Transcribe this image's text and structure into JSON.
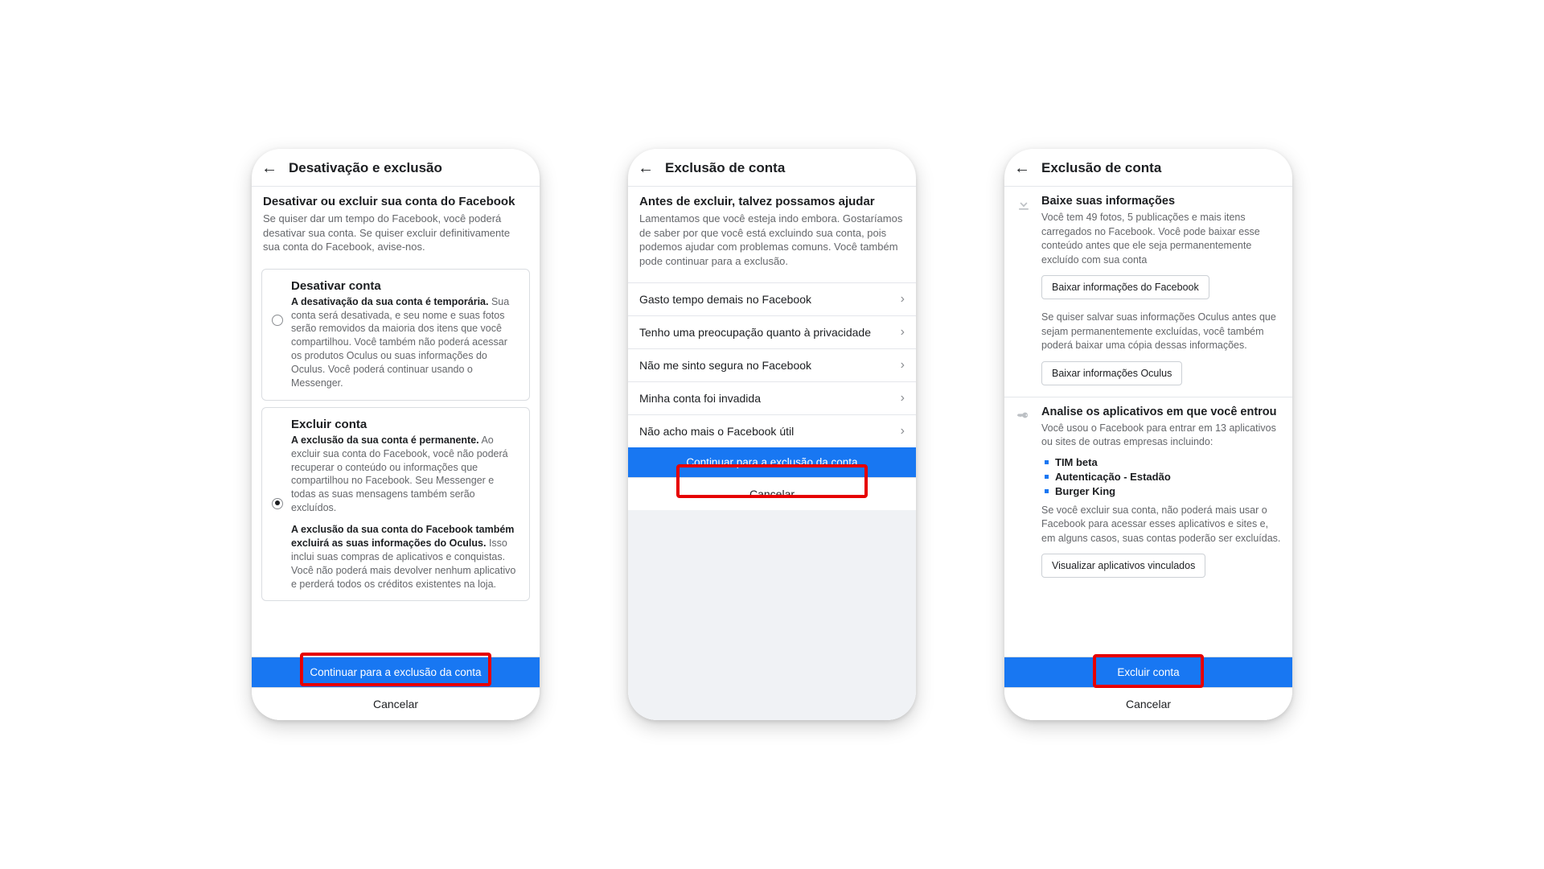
{
  "phone1": {
    "header": "Desativação e exclusão",
    "section_title": "Desativar ou excluir sua conta do Facebook",
    "section_desc": "Se quiser dar um tempo do Facebook, você poderá desativar sua conta. Se quiser excluir definitivamente sua conta do Facebook, avise-nos.",
    "opt_a_title": "Desativar conta",
    "opt_a_bold": "A desativação da sua conta é temporária.",
    "opt_a_rest": " Sua conta será desativada, e seu nome e suas fotos serão removidos da maioria dos itens que você compartilhou. Você também não poderá acessar os produtos Oculus ou suas informações do Oculus. Você poderá continuar usando o Messenger.",
    "opt_b_title": "Excluir conta",
    "opt_b_bold": "A exclusão da sua conta é permanente.",
    "opt_b_rest": " Ao excluir sua conta do Facebook, você não poderá recuperar o conteúdo ou informações que compartilhou no Facebook. Seu Messenger e todas as suas mensagens também serão excluídos.",
    "opt_b_bold2": "A exclusão da sua conta do Facebook também excluirá as suas informações do Oculus.",
    "opt_b_rest2": " Isso inclui suas compras de aplicativos e conquistas. Você não poderá mais devolver nenhum aplicativo e perderá todos os créditos existentes na loja.",
    "continue": "Continuar para a exclusão da conta",
    "cancel": "Cancelar"
  },
  "phone2": {
    "header": "Exclusão de conta",
    "title": "Antes de excluir, talvez possamos ajudar",
    "desc": "Lamentamos que você esteja indo embora. Gostaríamos de saber por que você está excluindo sua conta, pois podemos ajudar com problemas comuns. Você também pode continuar para a exclusão.",
    "reasons": [
      "Gasto tempo demais no Facebook",
      "Tenho uma preocupação quanto à privacidade",
      "Não me sinto segura no Facebook",
      "Minha conta foi invadida",
      "Não acho mais o Facebook útil"
    ],
    "continue": "Continuar para a exclusão da conta",
    "cancel": "Cancelar"
  },
  "phone3": {
    "header": "Exclusão de conta",
    "g1_title": "Baixe suas informações",
    "g1_text": "Você tem 49 fotos, 5 publicações e mais itens carregados no Facebook. Você pode baixar esse conteúdo antes que ele seja permanentemente excluído com sua conta",
    "g1_btn": "Baixar informações do Facebook",
    "g1_extra": "Se quiser salvar suas informações Oculus antes que sejam permanentemente excluídas, você também poderá baixar uma cópia dessas informações.",
    "g1_btn2": "Baixar informações Oculus",
    "g2_title": "Analise os aplicativos em que você entrou",
    "g2_text": "Você usou o Facebook para entrar em 13 aplicativos ou sites de outras empresas incluindo:",
    "g2_apps": [
      "TIM beta",
      "Autenticação - Estadão",
      "Burger King"
    ],
    "g2_after": "Se você excluir sua conta, não poderá mais usar o Facebook para acessar esses aplicativos e sites e, em alguns casos, suas contas poderão ser excluídas.",
    "g2_btn": "Visualizar aplicativos vinculados",
    "primary": "Excluir conta",
    "cancel": "Cancelar"
  }
}
